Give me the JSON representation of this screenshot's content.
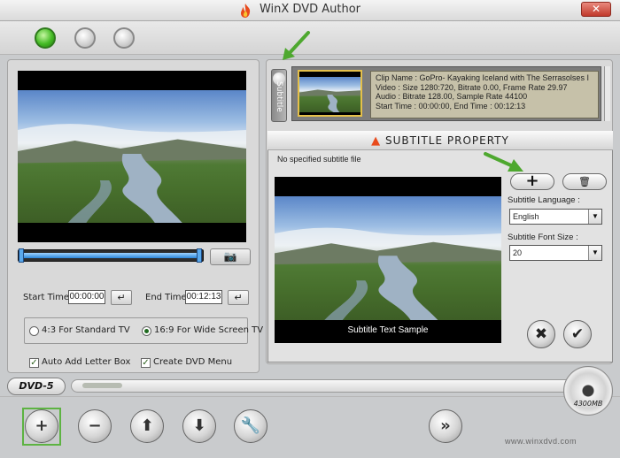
{
  "app": {
    "title": "WinX DVD Author",
    "close_glyph": "✕",
    "accent": "#5db342"
  },
  "top_panel": {
    "circles": [
      "active-green",
      "inactive",
      "inactive"
    ]
  },
  "left_panel": {
    "start_time_label": "Start Time :",
    "start_time_value": "00:00:00",
    "end_time_label": "End Time :",
    "end_time_value": "00:12:13",
    "enter_glyph": "↵",
    "camera_glyph": "📷",
    "aspect_standard_label": "4:3 For Standard TV",
    "aspect_wide_label": "16:9 For Wide Screen TV",
    "aspect_selected": "16:9 For Wide Screen TV",
    "auto_letterbox_label": "Auto Add Letter Box",
    "auto_letterbox_checked": true,
    "create_menu_label": "Create DVD Menu",
    "create_menu_checked": true,
    "check_glyph": "✓",
    "playback_progress": 1.0
  },
  "clip_list": {
    "tab_label": "Subtitle",
    "clip_name": "Clip Name : GoPro- Kayaking Iceland with The Serrasolses I",
    "video": "Video : Size 1280:720, Bitrate 0.00, Frame Rate 29.97",
    "audio": "Audio : Bitrate 128.00, Sample Rate 44100",
    "times": "Start Time : 00:00:00, End Time : 00:12:13"
  },
  "subtitle_dialog": {
    "title": "SUBTITLE PROPERTY",
    "no_file_text": "No specified subtitle file",
    "sample_text": "Subtitle Text Sample",
    "add_glyph": "+",
    "delete_glyph": "🗑",
    "language_label": "Subtitle Language :",
    "language_value": "English",
    "font_size_label": "Subtitle Font Size :",
    "font_size_value": "20",
    "select_arrow": "▼",
    "cancel_glyph": "✖",
    "ok_glyph": "✔"
  },
  "bottom": {
    "dvd_label": "DVD-5",
    "capacity_label": "4300MB",
    "capacity_used_fraction": 0.08,
    "add_glyph": "+",
    "remove_glyph": "−",
    "up_glyph": "⬆",
    "down_glyph": "⬇",
    "settings_glyph": "🔧",
    "next_glyph": "»",
    "website": "www.winxdvd.com"
  }
}
